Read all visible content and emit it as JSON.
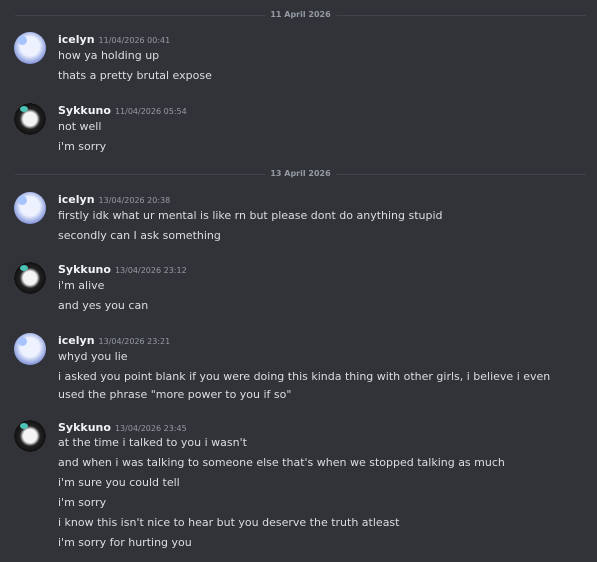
{
  "dividers": [
    "11 April 2026",
    "13 April 2026"
  ],
  "messages": [
    {
      "author": "icelyn",
      "timestamp": "11/04/2026 00:41",
      "lines": [
        "how ya holding up",
        "thats a pretty brutal expose"
      ]
    },
    {
      "author": "Sykkuno",
      "timestamp": "11/04/2026 05:54",
      "lines": [
        "not well",
        "i'm sorry"
      ]
    },
    {
      "author": "icelyn",
      "timestamp": "13/04/2026 20:38",
      "lines": [
        "firstly idk what ur mental is like rn but please dont do anything stupid",
        "secondly can I ask something"
      ]
    },
    {
      "author": "Sykkuno",
      "timestamp": "13/04/2026 23:12",
      "lines": [
        "i'm alive",
        "and yes you can"
      ]
    },
    {
      "author": "icelyn",
      "timestamp": "13/04/2026 23:21",
      "lines": [
        "whyd you lie",
        "i asked you point blank if you were doing this kinda thing with other girls, i believe i even used the phrase \"more power to you if so\""
      ]
    },
    {
      "author": "Sykkuno",
      "timestamp": "13/04/2026 23:45",
      "lines": [
        "at the time i talked to you i wasn't",
        "and when i was talking to someone else that's when we stopped talking as much",
        "i'm sure you could tell",
        "i'm sorry",
        "i know this isn't nice to hear but you deserve the truth atleast",
        "i'm sorry for hurting you"
      ]
    }
  ]
}
